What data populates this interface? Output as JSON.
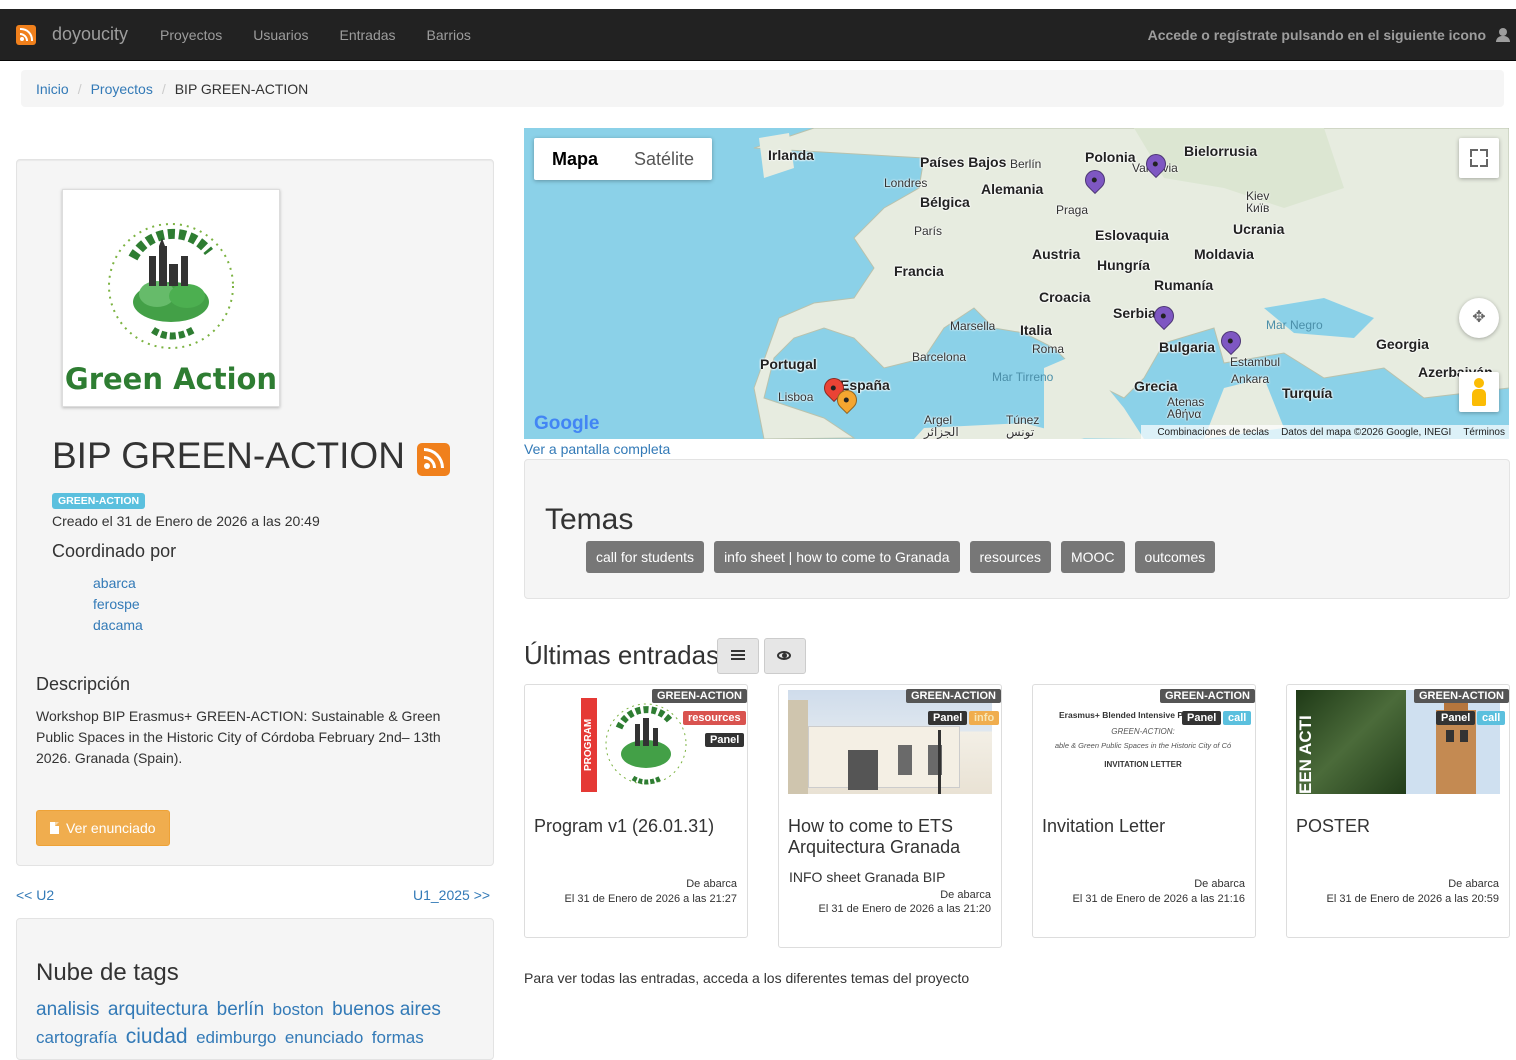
{
  "nav": {
    "brand": "doyoucity",
    "links": [
      "Proyectos",
      "Usuarios",
      "Entradas",
      "Barrios"
    ],
    "login_text": "Accede o regístrate pulsando en el siguiente icono"
  },
  "breadcrumb": {
    "home": "Inicio",
    "section": "Proyectos",
    "current": "BIP GREEN-ACTION"
  },
  "project": {
    "logo_text": "Green Action",
    "title": "BIP GREEN-ACTION",
    "label": "GREEN-ACTION",
    "created": "Creado el 31 de Enero de 2026 a las 20:49",
    "coordinated_heading": "Coordinado por",
    "coordinators": [
      "abarca",
      "ferospe",
      "dacama"
    ],
    "description_heading": "Descripción",
    "description": "Workshop BIP Erasmus+ GREEN-ACTION: Sustainable & Green Public Spaces in the Historic City of Córdoba February 2nd– 13th 2026. Granada (Spain).",
    "button": "Ver enunciado"
  },
  "pager": {
    "prev": "<< U2",
    "next": "U1_2025 >>"
  },
  "tags": {
    "heading": "Nube de tags",
    "items": [
      "analisis",
      "arquitectura",
      "berlín",
      "boston",
      "buenos aires",
      "cartografía",
      "ciudad",
      "edimburgo",
      "enunciado",
      "formas"
    ]
  },
  "map": {
    "toggle_map": "Mapa",
    "toggle_sat": "Satélite",
    "google": "Google",
    "footer": [
      "Combinaciones de teclas",
      "Datos del mapa ©2026 Google, INEGI",
      "Términos"
    ],
    "countries": [
      "Irlanda",
      "Países Bajos",
      "Alemania",
      "Bélgica",
      "Polonia",
      "Bielorrusia",
      "Ucrania",
      "Eslovaquia",
      "Austria",
      "Hungría",
      "Moldavia",
      "Francia",
      "Rumanía",
      "Croacia",
      "Serbia",
      "Italia",
      "Bulgaria",
      "Georgia",
      "Portugal",
      "España",
      "Grecia",
      "Turquía",
      "Azerbaiyán"
    ],
    "cities": [
      "Londres",
      "Berlín",
      "Praga",
      "París",
      "Varsovia",
      "Kiev Київ",
      "Marsella",
      "Roma",
      "Barcelona",
      "Lisboa",
      "Estambul",
      "Ankara",
      "Atenas Αθήνα",
      "Argel الجزائر",
      "Túnez تونس"
    ],
    "seas": [
      "Mar Negro",
      "Mar Tirreno"
    ],
    "full_link": "Ver a pantalla completa"
  },
  "temas": {
    "heading": "Temas",
    "items": [
      "call for students",
      "info sheet | how to come to Granada",
      "resources",
      "MOOC",
      "outcomes"
    ]
  },
  "entries": {
    "heading": "Últimas entradas",
    "cards": [
      {
        "project": "GREEN-ACTION",
        "chips": [
          "resources",
          "Panel"
        ],
        "title": "Program v1 (26.01.31)",
        "sub": "",
        "by": "De abarca",
        "date": "El 31 de Enero de 2026 a las 21:27",
        "thumb_text": "PROGRAM"
      },
      {
        "project": "GREEN-ACTION",
        "chips": [
          "Panel",
          "info"
        ],
        "title": "How to come to ETS Arquitectura Granada",
        "sub": "INFO sheet Granada BIP",
        "by": "De abarca",
        "date": "El 31 de Enero de 2026 a las 21:20",
        "thumb_text": ""
      },
      {
        "project": "GREEN-ACTION",
        "chips": [
          "Panel",
          "call"
        ],
        "title": "Invitation Letter",
        "sub": "",
        "by": "De abarca",
        "date": "El 31 de Enero de 2026 a las 21:16",
        "thumb_text": "Erasmus+ Blended Intensive P"
      },
      {
        "project": "GREEN-ACTION",
        "chips": [
          "Panel",
          "call"
        ],
        "title": "POSTER",
        "sub": "",
        "by": "De abarca",
        "date": "El 31 de Enero de 2026 a las 20:59",
        "thumb_text": "EEN ACTI"
      }
    ],
    "letter_lines": [
      "GREEN-ACTION:",
      "able & Green Public Spaces in the Historic City of Có",
      "INVITATION LETTER"
    ],
    "footer_note": "Para ver todas las entradas, acceda a los diferentes temas del proyecto"
  },
  "colors": {
    "accent": "#337ab7",
    "navbar": "#222222",
    "rss": "#f0801c",
    "warning": "#f0ad4e",
    "info": "#5bc0de",
    "danger": "#d9534f",
    "panel_chip": "#333333"
  }
}
